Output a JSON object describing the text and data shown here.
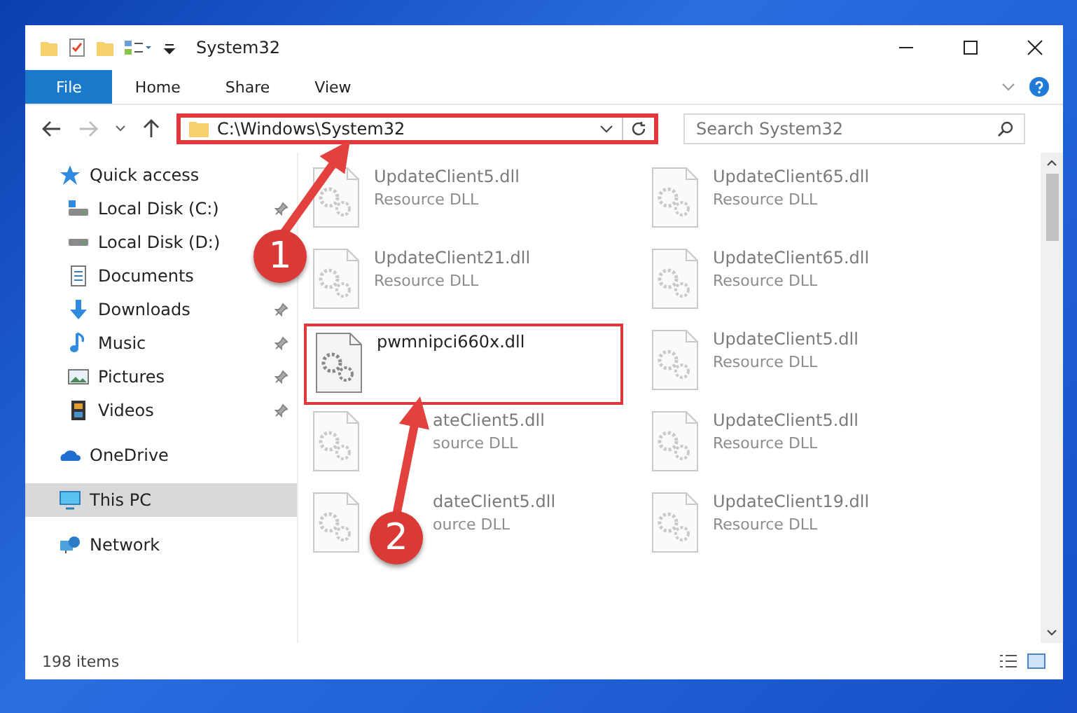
{
  "window": {
    "title": "System32"
  },
  "ribbon_tabs": [
    {
      "label": "File",
      "selected": true
    },
    {
      "label": "Home",
      "selected": false
    },
    {
      "label": "Share",
      "selected": false
    },
    {
      "label": "View",
      "selected": false
    }
  ],
  "address_bar": {
    "path": "C:\\Windows\\System32",
    "highlighted": true
  },
  "search": {
    "placeholder": "Search System32"
  },
  "sidebar": {
    "items": [
      {
        "label": "Quick access",
        "kind": "star",
        "selected": false,
        "children": [
          {
            "label": "Local Disk (C:)",
            "kind": "disk-c",
            "pinned": true,
            "selected": false
          },
          {
            "label": "Local Disk (D:)",
            "kind": "disk",
            "pinned": false,
            "selected": false
          },
          {
            "label": "Documents",
            "kind": "document",
            "pinned": false,
            "selected": false
          },
          {
            "label": "Downloads",
            "kind": "download",
            "pinned": true,
            "selected": false
          },
          {
            "label": "Music",
            "kind": "music",
            "pinned": true,
            "selected": false
          },
          {
            "label": "Pictures",
            "kind": "pictures",
            "pinned": true,
            "selected": false
          },
          {
            "label": "Videos",
            "kind": "videos",
            "pinned": true,
            "selected": false
          }
        ]
      },
      {
        "label": "OneDrive",
        "kind": "cloud",
        "selected": false
      },
      {
        "label": "This PC",
        "kind": "pc",
        "selected": true
      },
      {
        "label": "Network",
        "kind": "network",
        "selected": false
      }
    ]
  },
  "files": [
    {
      "name": "UpdateClient5.dll",
      "type": "Resource DLL",
      "blurred": true,
      "highlighted": false,
      "covered": false
    },
    {
      "name": "UpdateClient65.dll",
      "type": "Resource DLL",
      "blurred": true,
      "highlighted": false,
      "covered": false
    },
    {
      "name": "UpdateClient21.dll",
      "type": "Resource DLL",
      "blurred": true,
      "highlighted": false,
      "covered": false
    },
    {
      "name": "UpdateClient65.dll",
      "type": "Resource DLL",
      "blurred": true,
      "highlighted": false,
      "covered": false
    },
    {
      "name": "pwmnipci660x.dll",
      "blurred": false,
      "highlighted": true,
      "covered": false
    },
    {
      "name": "UpdateClient5.dll",
      "type": "Resource DLL",
      "blurred": true,
      "highlighted": false,
      "covered": false
    },
    {
      "name": "ateClient5.dll",
      "type": "source DLL",
      "blurred": true,
      "highlighted": false,
      "covered": true
    },
    {
      "name": "UpdateClient5.dll",
      "type": "Resource DLL",
      "blurred": true,
      "highlighted": false,
      "covered": false
    },
    {
      "name": "dateClient5.dll",
      "type": "ource DLL",
      "blurred": true,
      "highlighted": false,
      "covered": true
    },
    {
      "name": "UpdateClient19.dll",
      "type": "Resource DLL",
      "blurred": true,
      "highlighted": false,
      "covered": false
    }
  ],
  "callouts": [
    {
      "number": "1"
    },
    {
      "number": "2"
    }
  ],
  "status_bar": {
    "count": "198 items"
  }
}
